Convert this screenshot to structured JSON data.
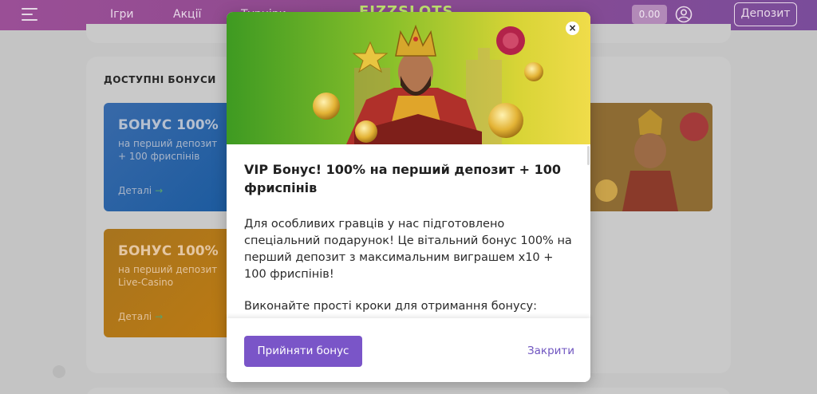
{
  "header": {
    "nav": [
      "Ігри",
      "Акції",
      "Турніри"
    ],
    "logo": "FIZZSLOTS",
    "balance": "0.00",
    "deposit_label": "Депозит"
  },
  "bonuses": {
    "section_title": "ДОСТУПНІ БОНУСИ",
    "cards": [
      {
        "title": "БОНУС 100%",
        "line1": "на перший депозит",
        "line2": "+ 100 фриспінів",
        "details": "Деталі"
      },
      {
        "title": "БОНУС 100%",
        "line1": "на перший депозит",
        "line2": "Live-Casino",
        "details": "Деталі"
      }
    ]
  },
  "modal": {
    "title": "VIP Бонус! 100% на перший депозит + 100 фриспінів",
    "body_1": "Для особливих гравців у нас підготовлено спеціальний подарунок! Це вітальний бонус 100% на перший депозит з максимальним виграшем х10 + 100 фриспінів!",
    "body_2": "Виконайте прості кроки для отримання бонусу:",
    "close_glyph": "×",
    "accept_label": "Прийняти бонус",
    "close_label": "Закрити"
  },
  "colors": {
    "accent": "#7a55c8",
    "link": "#6f55c0",
    "header": "#8f4a8f"
  }
}
